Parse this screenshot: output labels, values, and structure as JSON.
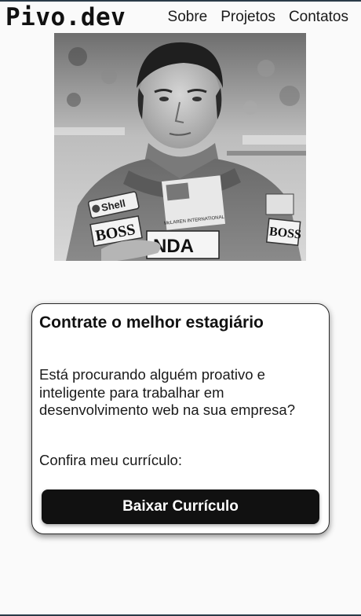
{
  "header": {
    "logo_text": "Pivo.dev",
    "nav": [
      {
        "label": "Sobre"
      },
      {
        "label": "Projetos"
      },
      {
        "label": "Contatos"
      }
    ]
  },
  "hero": {
    "photo_alt": "black and white portrait of a racing driver",
    "suit_texts": [
      "Shell",
      "BOSS",
      "BOSS",
      "NDA",
      "McLAREN INTERNATIONAL"
    ]
  },
  "card": {
    "title": "Contrate o melhor estagiário",
    "description": "Está procurando alguém proativo e inteligente para trabalhar em desenvolvimento web na sua empresa?",
    "prompt": "Confira meu currículo:",
    "button_label": "Baixar Currículo"
  }
}
